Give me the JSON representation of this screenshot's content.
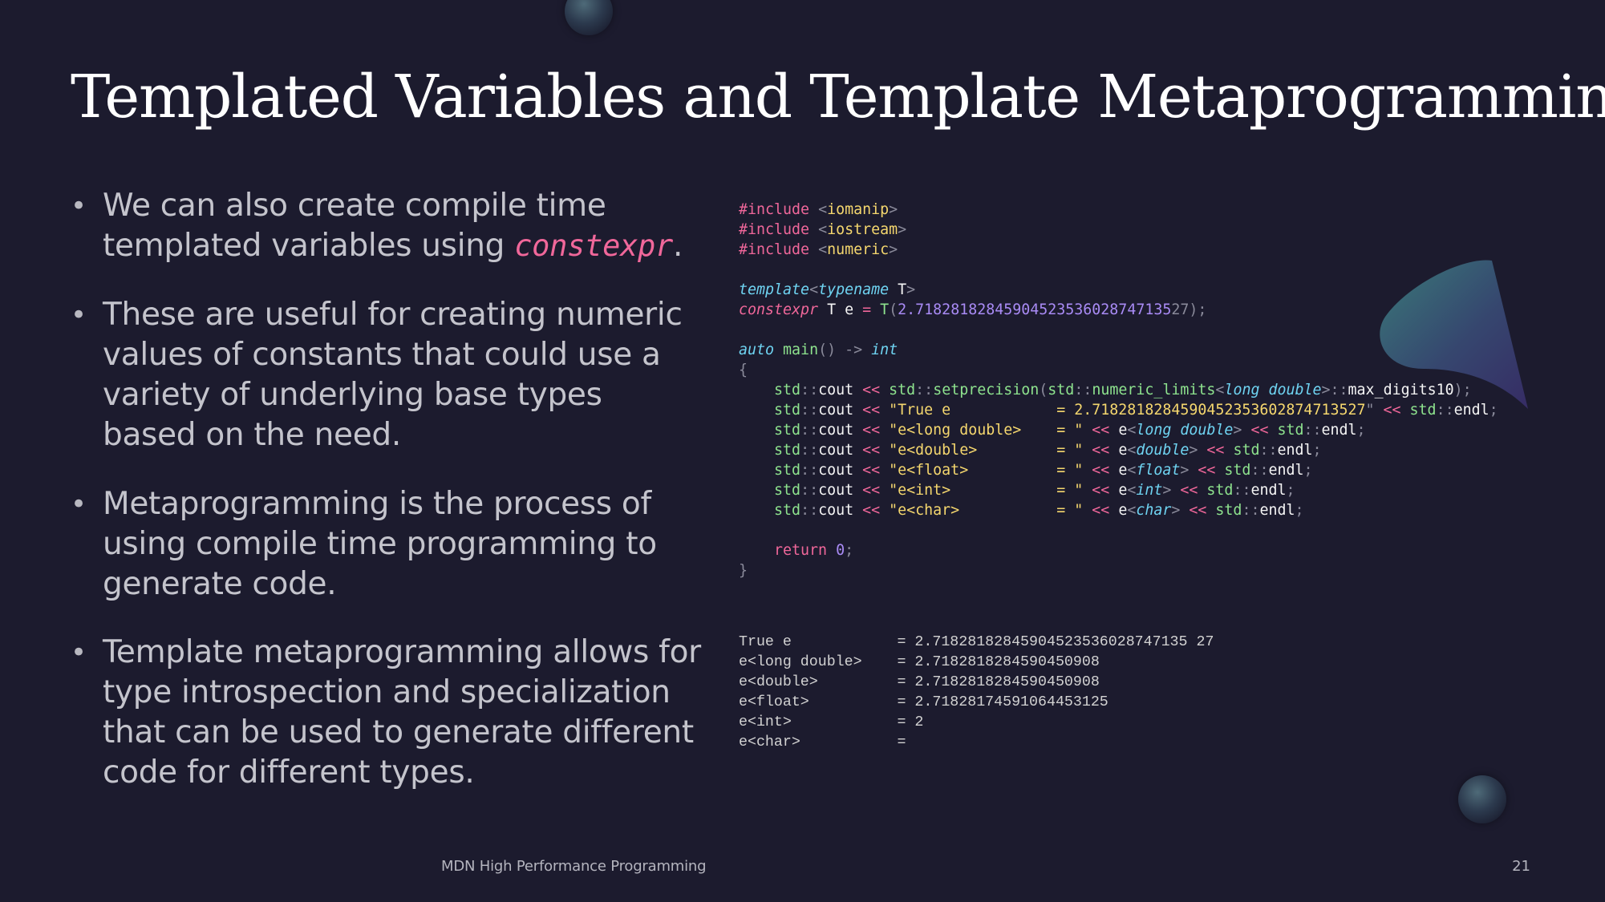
{
  "slide": {
    "title": "Templated Variables and Template Metaprogramming",
    "footer": "MDN High Performance Programming",
    "page_number": "21"
  },
  "bullets": [
    {
      "text": "We can also create compile time templated variables using ",
      "keyword": "constexpr",
      "suffix": "."
    },
    {
      "text": "These are useful for creating numeric values of constants that could use a variety of underlying base types based on the need."
    },
    {
      "text": "Metaprogramming is the process of using compile time programming to generate code."
    },
    {
      "text": "Template metaprogramming allows for type introspection and specialization that can be used to generate different code for different types."
    }
  ],
  "code": {
    "lines": [
      [
        [
          "pp",
          "#include "
        ],
        [
          "pu",
          "<"
        ],
        [
          "hdr",
          "iomanip"
        ],
        [
          "pu",
          ">"
        ]
      ],
      [
        [
          "pp",
          "#include "
        ],
        [
          "pu",
          "<"
        ],
        [
          "hdr",
          "iostream"
        ],
        [
          "pu",
          ">"
        ]
      ],
      [
        [
          "pp",
          "#include "
        ],
        [
          "pu",
          "<"
        ],
        [
          "hdr",
          "numeric"
        ],
        [
          "pu",
          ">"
        ]
      ],
      [],
      [
        [
          "kw",
          "template"
        ],
        [
          "pu",
          "<"
        ],
        [
          "kw",
          "typename"
        ],
        [
          "tx",
          " T"
        ],
        [
          "pu",
          ">"
        ]
      ],
      [
        [
          "pk",
          "constexpr"
        ],
        [
          "tx",
          " T e "
        ],
        [
          "op",
          "="
        ],
        [
          "tx",
          " "
        ],
        [
          "fn",
          "T"
        ],
        [
          "pu",
          "("
        ],
        [
          "num",
          "2.71828182845904523536028747135"
        ],
        [
          "pu",
          "27);"
        ]
      ],
      [],
      [
        [
          "kw",
          "auto"
        ],
        [
          "tx",
          " "
        ],
        [
          "fn",
          "main"
        ],
        [
          "pu",
          "() -> "
        ],
        [
          "ty",
          "int"
        ]
      ],
      [
        [
          "pu",
          "{"
        ]
      ],
      [
        [
          "tx",
          "    "
        ],
        [
          "ns",
          "std"
        ],
        [
          "pu",
          "::"
        ],
        [
          "tx",
          "cout "
        ],
        [
          "op",
          "<<"
        ],
        [
          "tx",
          " "
        ],
        [
          "ns",
          "std"
        ],
        [
          "pu",
          "::"
        ],
        [
          "fn",
          "setprecision"
        ],
        [
          "pu",
          "("
        ],
        [
          "ns",
          "std"
        ],
        [
          "pu",
          "::"
        ],
        [
          "ns",
          "numeric_limits"
        ],
        [
          "pu",
          "<"
        ],
        [
          "ty",
          "long double"
        ],
        [
          "pu",
          ">::"
        ],
        [
          "tx",
          "max_digits10"
        ],
        [
          "pu",
          ");"
        ]
      ],
      [
        [
          "tx",
          "    "
        ],
        [
          "ns",
          "std"
        ],
        [
          "pu",
          "::"
        ],
        [
          "tx",
          "cout "
        ],
        [
          "op",
          "<<"
        ],
        [
          "tx",
          " "
        ],
        [
          "str",
          "\"True e            = 2.71828182845904523536028747135"
        ],
        [
          "str",
          "27"
        ],
        [
          "pu",
          "\" "
        ],
        [
          "op",
          "<<"
        ],
        [
          "tx",
          " "
        ],
        [
          "ns",
          "std"
        ],
        [
          "pu",
          "::"
        ],
        [
          "tx",
          "endl"
        ],
        [
          "pu",
          ";"
        ]
      ],
      [
        [
          "tx",
          "    "
        ],
        [
          "ns",
          "std"
        ],
        [
          "pu",
          "::"
        ],
        [
          "tx",
          "cout "
        ],
        [
          "op",
          "<<"
        ],
        [
          "tx",
          " "
        ],
        [
          "str",
          "\"e<long double>    = \""
        ],
        [
          "tx",
          " "
        ],
        [
          "op",
          "<<"
        ],
        [
          "tx",
          " e"
        ],
        [
          "pu",
          "<"
        ],
        [
          "ty",
          "long double"
        ],
        [
          "pu",
          "> "
        ],
        [
          "op",
          "<<"
        ],
        [
          "tx",
          " "
        ],
        [
          "ns",
          "std"
        ],
        [
          "pu",
          "::"
        ],
        [
          "tx",
          "endl"
        ],
        [
          "pu",
          ";"
        ]
      ],
      [
        [
          "tx",
          "    "
        ],
        [
          "ns",
          "std"
        ],
        [
          "pu",
          "::"
        ],
        [
          "tx",
          "cout "
        ],
        [
          "op",
          "<<"
        ],
        [
          "tx",
          " "
        ],
        [
          "str",
          "\"e<double>         = \""
        ],
        [
          "tx",
          " "
        ],
        [
          "op",
          "<<"
        ],
        [
          "tx",
          " e"
        ],
        [
          "pu",
          "<"
        ],
        [
          "ty",
          "double"
        ],
        [
          "pu",
          "> "
        ],
        [
          "op",
          "<<"
        ],
        [
          "tx",
          " "
        ],
        [
          "ns",
          "std"
        ],
        [
          "pu",
          "::"
        ],
        [
          "tx",
          "endl"
        ],
        [
          "pu",
          ";"
        ]
      ],
      [
        [
          "tx",
          "    "
        ],
        [
          "ns",
          "std"
        ],
        [
          "pu",
          "::"
        ],
        [
          "tx",
          "cout "
        ],
        [
          "op",
          "<<"
        ],
        [
          "tx",
          " "
        ],
        [
          "str",
          "\"e<float>          = \""
        ],
        [
          "tx",
          " "
        ],
        [
          "op",
          "<<"
        ],
        [
          "tx",
          " e"
        ],
        [
          "pu",
          "<"
        ],
        [
          "ty",
          "float"
        ],
        [
          "pu",
          "> "
        ],
        [
          "op",
          "<<"
        ],
        [
          "tx",
          " "
        ],
        [
          "ns",
          "std"
        ],
        [
          "pu",
          "::"
        ],
        [
          "tx",
          "endl"
        ],
        [
          "pu",
          ";"
        ]
      ],
      [
        [
          "tx",
          "    "
        ],
        [
          "ns",
          "std"
        ],
        [
          "pu",
          "::"
        ],
        [
          "tx",
          "cout "
        ],
        [
          "op",
          "<<"
        ],
        [
          "tx",
          " "
        ],
        [
          "str",
          "\"e<int>            = \""
        ],
        [
          "tx",
          " "
        ],
        [
          "op",
          "<<"
        ],
        [
          "tx",
          " e"
        ],
        [
          "pu",
          "<"
        ],
        [
          "ty",
          "int"
        ],
        [
          "pu",
          "> "
        ],
        [
          "op",
          "<<"
        ],
        [
          "tx",
          " "
        ],
        [
          "ns",
          "std"
        ],
        [
          "pu",
          "::"
        ],
        [
          "tx",
          "endl"
        ],
        [
          "pu",
          ";"
        ]
      ],
      [
        [
          "tx",
          "    "
        ],
        [
          "ns",
          "std"
        ],
        [
          "pu",
          "::"
        ],
        [
          "tx",
          "cout "
        ],
        [
          "op",
          "<<"
        ],
        [
          "tx",
          " "
        ],
        [
          "str",
          "\"e<char>           = \""
        ],
        [
          "tx",
          " "
        ],
        [
          "op",
          "<<"
        ],
        [
          "tx",
          " e"
        ],
        [
          "pu",
          "<"
        ],
        [
          "ty",
          "char"
        ],
        [
          "pu",
          "> "
        ],
        [
          "op",
          "<<"
        ],
        [
          "tx",
          " "
        ],
        [
          "ns",
          "std"
        ],
        [
          "pu",
          "::"
        ],
        [
          "tx",
          "endl"
        ],
        [
          "pu",
          ";"
        ]
      ],
      [],
      [
        [
          "tx",
          "    "
        ],
        [
          "ret",
          "return"
        ],
        [
          "tx",
          " "
        ],
        [
          "num",
          "0"
        ],
        [
          "pu",
          ";"
        ]
      ],
      [
        [
          "pu",
          "}"
        ]
      ]
    ]
  },
  "output": {
    "lines": [
      "True e            = 2.71828182845904523536028747135 27",
      "e<long double>    = 2.7182818284590450908",
      "e<double>         = 2.7182818284590450908",
      "e<float>          = 2.71828174591064453125",
      "e<int>            = 2",
      "e<char>           = "
    ]
  },
  "colors": {
    "background": "#1c1b2e",
    "keyword_pink": "#f0679a",
    "type_cyan": "#6fd4f2",
    "ident_green": "#8ee38e",
    "string_yellow": "#f5d76e",
    "number_purple": "#a98bf5"
  }
}
